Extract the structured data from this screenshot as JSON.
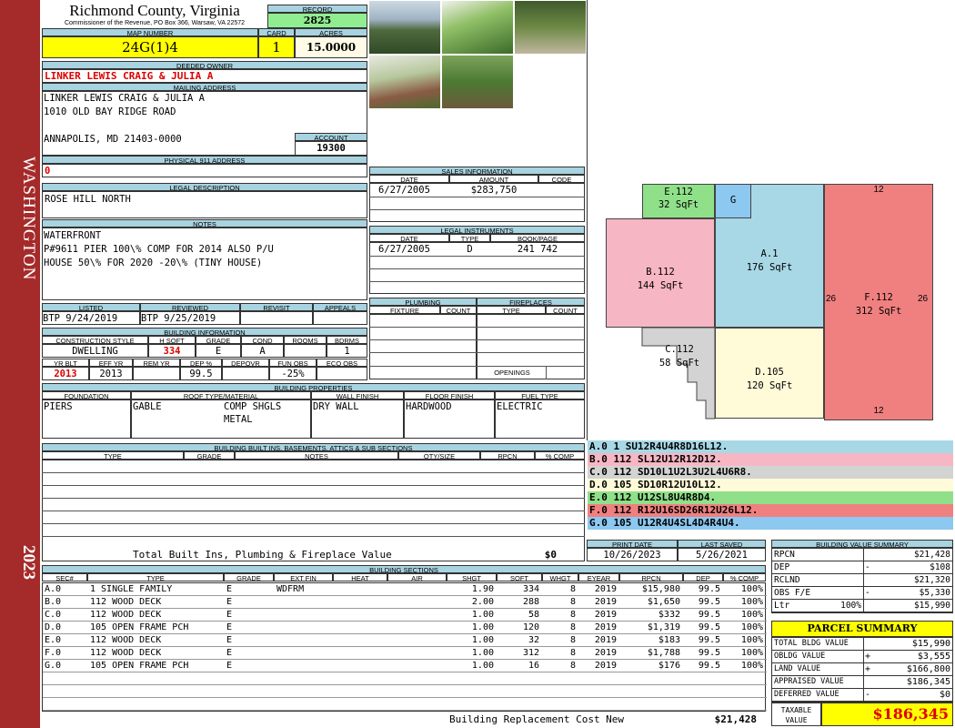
{
  "sidebar": {
    "county": "WASHINGTON",
    "year": "2023"
  },
  "header": {
    "county_title": "Richmond County, Virginia",
    "commissioner": "Commissioner of the Revenue, PO Box 366, Warsaw, VA 22572",
    "record_label": "RECORD",
    "record": "2825",
    "map_label": "MAP NUMBER",
    "map_number": "24G(1)4",
    "card_label": "CARD",
    "card": "1",
    "acres_label": "ACRES",
    "acres": "15.0000"
  },
  "owner": {
    "deeded_label": "DEEDED OWNER",
    "deeded_owner": "LINKER LEWIS CRAIG & JULIA A",
    "mailing_label": "MAILING ADDRESS",
    "mailing_line1": "LINKER LEWIS CRAIG & JULIA A",
    "mailing_line2": "1010 OLD BAY RIDGE ROAD",
    "mailing_line3": "ANNAPOLIS, MD 21403-0000",
    "account_label": "ACCOUNT",
    "account": "19300",
    "physical_label": "PHYSICAL 911 ADDRESS",
    "physical": "0"
  },
  "legal": {
    "label": "LEGAL DESCRIPTION",
    "text": "ROSE HILL NORTH"
  },
  "notes": {
    "label": "NOTES",
    "line1": "WATERFRONT",
    "line2": "P#9611 PIER 100\\% COMP FOR 2014 ALSO P/U",
    "line3": "HOUSE 50\\% FOR 2020 -20\\% (TINY HOUSE)"
  },
  "sales": {
    "label": "SALES INFORMATION",
    "h_date": "DATE",
    "h_amount": "AMOUNT",
    "h_code": "CODE",
    "date": "6/27/2005",
    "amount": "$283,750",
    "code": ""
  },
  "instruments": {
    "label": "LEGAL INSTRUMENTS",
    "h_date": "DATE",
    "h_type": "TYPE",
    "h_book": "BOOK/PAGE",
    "date": "6/27/2005",
    "type": "D",
    "book": "241 742"
  },
  "status": {
    "listed_label": "LISTED",
    "reviewed_label": "REVIEWED",
    "revisit_label": "REVISIT",
    "appeals_label": "APPEALS",
    "listed": "BTP  9/24/2019",
    "reviewed": "BTP  9/25/2019",
    "revisit": "",
    "appeals": ""
  },
  "building_info": {
    "label": "BUILDING INFORMATION",
    "h_style": "CONSTRUCTION STYLE",
    "h_hsqft": "H SQFT",
    "h_grade": "GRADE",
    "h_cond": "COND",
    "h_rooms": "ROOMS",
    "h_bdrms": "BDRMS",
    "style": "DWELLING",
    "hsqft": "334",
    "grade": "E",
    "cond": "A",
    "rooms": "",
    "bdrms": "1",
    "h_yrblt": "YR BLT",
    "h_effyr": "EFF YR",
    "h_remyr": "REM YR",
    "h_dep": "DEP %",
    "h_depovr": "DEPOVR",
    "h_funobs": "FUN OBS",
    "h_ecoobs": "ECO OBS",
    "yrblt": "2013",
    "effyr": "2013",
    "remyr": "",
    "dep": "99.5",
    "depovr": "",
    "funobs": "-25%",
    "ecoobs": ""
  },
  "plumbing": {
    "label": "PLUMBING",
    "h_fixture": "FIXTURE",
    "h_count": "COUNT"
  },
  "fireplaces": {
    "label": "FIREPLACES",
    "h_type": "TYPE",
    "h_count": "COUNT",
    "openings": "OPENINGS"
  },
  "properties": {
    "label": "BUILDING PROPERTIES",
    "h_foundation": "FOUNDATION",
    "h_roof": "ROOF TYPE/MATERIAL",
    "h_wall": "WALL FINISH",
    "h_floor": "FLOOR FINISH",
    "h_fuel": "FUEL TYPE",
    "foundation": "PIERS",
    "roof_type": "GABLE",
    "roof_mat1": "COMP SHGLS",
    "roof_mat2": "METAL",
    "wall": "DRY WALL",
    "floor": "HARDWOOD",
    "fuel": "ELECTRIC"
  },
  "builtins": {
    "label": "BUILDING BUILT INS, BASEMENTS, ATTICS & SUB SECTIONS",
    "h_type": "TYPE",
    "h_grade": "GRADE",
    "h_notes": "NOTES",
    "h_qty": "QTY/SIZE",
    "h_rpcn": "RPCN",
    "h_comp": "% COMP",
    "total_label": "Total Built Ins, Plumbing & Fireplace Value",
    "total": "$0"
  },
  "dates": {
    "print_label": "PRINT DATE",
    "saved_label": "LAST SAVED",
    "print": "10/26/2023",
    "saved": "5/26/2021"
  },
  "sketch": {
    "areas": [
      {
        "code": "E.112",
        "size": "32 SqFt",
        "color": "#90e08a"
      },
      {
        "code": "G",
        "size": "",
        "color": "#8cc8f0"
      },
      {
        "code": "B.112",
        "size": "144 SqFt",
        "color": "#f7b6c3"
      },
      {
        "code": "A.1",
        "size": "176 SqFt",
        "color": "#a8d8e6"
      },
      {
        "code": "F.112",
        "size": "312 SqFt",
        "color": "#f08080"
      },
      {
        "code": "C.112",
        "size": "58 SqFt",
        "color": "#d3d3d3"
      },
      {
        "code": "D.105",
        "size": "120 SqFt",
        "color": "#fffbd8"
      }
    ],
    "dim_top": "12",
    "dim_bottom": "12",
    "dim_left": "26",
    "dim_right": "26"
  },
  "segments": [
    {
      "text": "A.0  1    SU12R4U4R8D16L12.",
      "color": "#a8d8e6"
    },
    {
      "text": "B.0  112  SL12U12R12D12.",
      "color": "#f7b6c3"
    },
    {
      "text": "C.0  112  SD10L1U2L3U2L4U6R8.",
      "color": "#d3d3d3"
    },
    {
      "text": "D.0  105  SD10R12U10L12.",
      "color": "#fffbd8"
    },
    {
      "text": "E.0  112  U12SL8U4R8D4.",
      "color": "#90e08a"
    },
    {
      "text": "F.0  112  R12U16SD26R12U26L12.",
      "color": "#f08080"
    },
    {
      "text": "G.0  105  U12R4U4SL4D4R4U4.",
      "color": "#8cc8f0"
    }
  ],
  "sections": {
    "label": "BUILDING SECTIONS",
    "headers": [
      "SEC#",
      "TYPE",
      "GRADE",
      "EXT FIN",
      "HEAT",
      "AIR",
      "SHGT",
      "SQFT",
      "WHGT",
      "EYEAR",
      "RPCN",
      "DEP",
      "% COMP"
    ],
    "rows": [
      [
        "A.0",
        "1 SINGLE FAMILY",
        "E",
        "WDFRM",
        "",
        "",
        "1.90",
        "334",
        "8",
        "2019",
        "$15,980",
        "99.5",
        "100%"
      ],
      [
        "B.0",
        "112 WOOD DECK",
        "E",
        "",
        "",
        "",
        "2.00",
        "288",
        "8",
        "2019",
        "$1,650",
        "99.5",
        "100%"
      ],
      [
        "C.0",
        "112 WOOD DECK",
        "E",
        "",
        "",
        "",
        "1.00",
        "58",
        "8",
        "2019",
        "$332",
        "99.5",
        "100%"
      ],
      [
        "D.0",
        "105 OPEN FRAME PCH",
        "E",
        "",
        "",
        "",
        "1.00",
        "120",
        "8",
        "2019",
        "$1,319",
        "99.5",
        "100%"
      ],
      [
        "E.0",
        "112 WOOD DECK",
        "E",
        "",
        "",
        "",
        "1.00",
        "32",
        "8",
        "2019",
        "$183",
        "99.5",
        "100%"
      ],
      [
        "F.0",
        "112 WOOD DECK",
        "E",
        "",
        "",
        "",
        "1.00",
        "312",
        "8",
        "2019",
        "$1,788",
        "99.5",
        "100%"
      ],
      [
        "G.0",
        "105 OPEN FRAME PCH",
        "E",
        "",
        "",
        "",
        "1.00",
        "16",
        "8",
        "2019",
        "$176",
        "99.5",
        "100%"
      ]
    ],
    "replacement_label": "Building Replacement Cost New",
    "replacement": "$21,428"
  },
  "value_summary": {
    "label": "BUILDING VALUE SUMMARY",
    "rows": [
      {
        "k": "RPCN",
        "op": "",
        "pct": "",
        "v": "$21,428"
      },
      {
        "k": "DEP",
        "op": "-",
        "pct": "",
        "v": "$108"
      },
      {
        "k": "RCLND",
        "op": "",
        "pct": "",
        "v": "$21,320"
      },
      {
        "k": "OBS F/E",
        "op": "-",
        "pct": "",
        "v": "$5,330"
      },
      {
        "k": "Ltr",
        "op": "",
        "pct": "100%",
        "v": "$15,990"
      }
    ]
  },
  "parcel": {
    "label": "PARCEL SUMMARY",
    "rows": [
      {
        "k": "TOTAL BLDG VALUE",
        "op": "",
        "v": "$15,990"
      },
      {
        "k": "OBLDG VALUE",
        "op": "+",
        "v": "$3,555"
      },
      {
        "k": "LAND VALUE",
        "op": "+",
        "v": "$166,800"
      },
      {
        "k": "APPRAISED VALUE",
        "op": "",
        "v": "$186,345"
      },
      {
        "k": "DEFERRED VALUE",
        "op": "-",
        "v": "$0"
      }
    ],
    "taxable_label": "TAXABLE VALUE",
    "taxable": "$186,345"
  }
}
